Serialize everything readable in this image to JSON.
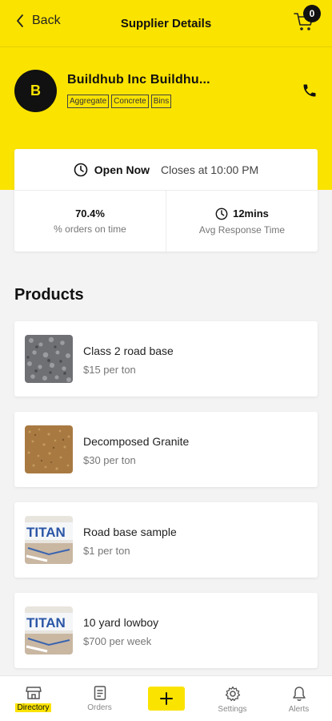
{
  "header": {
    "back_label": "Back",
    "title": "Supplier Details",
    "cart_count": "0"
  },
  "supplier": {
    "avatar_letter": "B",
    "name": "Buildhub Inc Buildhu...",
    "tags": [
      "Aggregate",
      "Concrete",
      "Bins"
    ]
  },
  "status": {
    "open_label": "Open Now",
    "closes_label": "Closes at 10:00 PM",
    "orders_on_time_value": "70.4%",
    "orders_on_time_label": "% orders on time",
    "response_value": "12mins",
    "response_label": "Avg Response Time"
  },
  "products_heading": "Products",
  "products": [
    {
      "name": "Class 2 road base",
      "price": "$15  per ton"
    },
    {
      "name": "Decomposed Granite",
      "price": "$30  per ton"
    },
    {
      "name": "Road base sample",
      "price": "$1  per ton"
    },
    {
      "name": "10 yard lowboy",
      "price": "$700  per week"
    }
  ],
  "tabbar": {
    "directory": "Directory",
    "orders": "Orders",
    "settings": "Settings",
    "alerts": "Alerts"
  },
  "thumb_text": "TITAN",
  "colors": {
    "accent": "#fbe300",
    "dark": "#111111"
  }
}
